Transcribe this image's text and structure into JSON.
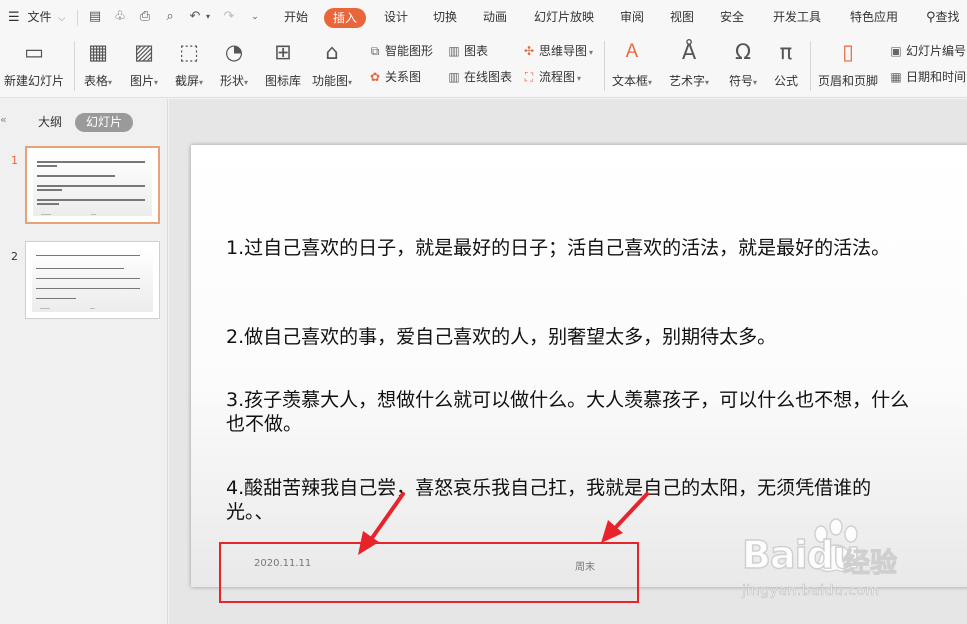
{
  "menubar": {
    "file": "文件",
    "tabs": [
      "开始",
      "插入",
      "设计",
      "切换",
      "动画",
      "幻灯片放映",
      "审阅",
      "视图",
      "安全",
      "开发工具",
      "特色应用"
    ],
    "active_tab": "插入",
    "search": "查找"
  },
  "ribbon": {
    "new_slide": "新建幻灯片",
    "table": "表格",
    "picture": "图片",
    "screenshot": "截屏",
    "shape": "形状",
    "icon_lib": "图标库",
    "func_chart": "功能图",
    "smart_art": "智能图形",
    "chart": "图表",
    "mind_map": "思维导图",
    "relation": "关系图",
    "online_chart": "在线图表",
    "flowchart": "流程图",
    "textbox": "文本框",
    "wordart": "艺术字",
    "symbol": "符号",
    "formula": "公式",
    "header_footer": "页眉和页脚",
    "slide_number": "幻灯片编号",
    "date_time": "日期和时间"
  },
  "panel": {
    "tab_outline": "大纲",
    "tab_slides": "幻灯片",
    "slide_numbers": [
      "1",
      "2"
    ]
  },
  "slide": {
    "paragraphs": [
      "1.过自己喜欢的日子，就是最好的日子；活自己喜欢的活法，就是最好的活法。",
      "2.做自己喜欢的事，爱自己喜欢的人，别奢望太多，别期待太多。",
      "3.孩子羡慕大人，想做什么就可以做什么。大人羡慕孩子，可以什么也不想，什么也不做。",
      "4.酸甜苦辣我自己尝，喜怒哀乐我自己扛，我就是自己的太阳，无须凭借谁的光。、"
    ],
    "footer_date": "2020.11.11",
    "footer_text": "周末"
  },
  "watermark": {
    "brand": "Baidu",
    "product": "经验",
    "url": "jingyan.baidu.com"
  },
  "colors": {
    "accent": "#e8663a",
    "annotation_red": "#e8242b"
  }
}
